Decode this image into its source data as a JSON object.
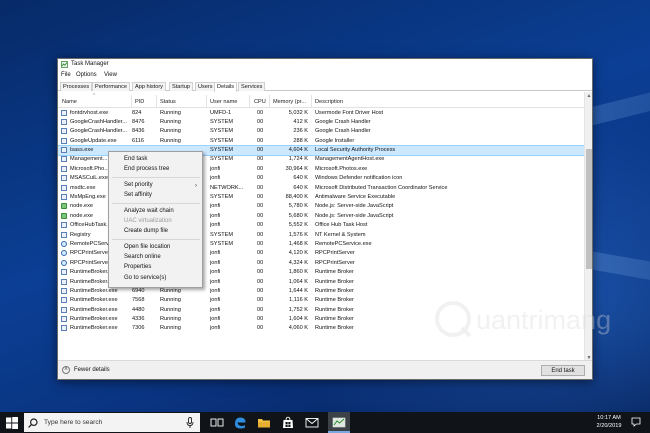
{
  "window": {
    "title": "Task Manager",
    "menu": [
      "File",
      "Options",
      "View"
    ],
    "tabs": [
      "Processes",
      "Performance",
      "App history",
      "Startup",
      "Users",
      "Details",
      "Services"
    ],
    "active_tab": "Details"
  },
  "table": {
    "columns": [
      "Name",
      "PID",
      "Status",
      "User name",
      "CPU",
      "Memory (pr...",
      "Description"
    ],
    "rows": [
      {
        "name": "fontdrvhost.exe",
        "pid": "824",
        "status": "Running",
        "user": "UMFD-1",
        "cpu": "00",
        "memory": "5,032 K",
        "description": "Usermode Font Driver Host",
        "icon": "app"
      },
      {
        "name": "GoogleCrashHandler...",
        "pid": "8476",
        "status": "Running",
        "user": "SYSTEM",
        "cpu": "00",
        "memory": "412 K",
        "description": "Google Crash Handler",
        "icon": "app"
      },
      {
        "name": "GoogleCrashHandler...",
        "pid": "8436",
        "status": "Running",
        "user": "SYSTEM",
        "cpu": "00",
        "memory": "236 K",
        "description": "Google Crash Handler",
        "icon": "app"
      },
      {
        "name": "GoogleUpdate.exe",
        "pid": "6116",
        "status": "Running",
        "user": "SYSTEM",
        "cpu": "00",
        "memory": "288 K",
        "description": "Google Installer",
        "icon": "app"
      },
      {
        "name": "lsass.exe",
        "pid": "",
        "status": "",
        "user": "SYSTEM",
        "cpu": "00",
        "memory": "4,604 K",
        "description": "Local Security Authority Process",
        "icon": "app",
        "selected": true
      },
      {
        "name": "Management...",
        "pid": "",
        "status": "",
        "user": "SYSTEM",
        "cpu": "00",
        "memory": "1,724 K",
        "description": "ManagementAgentHost.exe",
        "icon": "app"
      },
      {
        "name": "Microsoft.Pho...",
        "pid": "",
        "status": "",
        "user": "jonfi",
        "cpu": "00",
        "memory": "30,964 K",
        "description": "Microsoft.Photos.exe",
        "icon": "app"
      },
      {
        "name": "MSASCuiL.exe",
        "pid": "",
        "status": "",
        "user": "jonfi",
        "cpu": "00",
        "memory": "640 K",
        "description": "Windows Defender notification icon",
        "icon": "app"
      },
      {
        "name": "msdtc.exe",
        "pid": "",
        "status": "",
        "user": "NETWORK...",
        "cpu": "00",
        "memory": "640 K",
        "description": "Microsoft Distributed Transaction Coordinator Service",
        "icon": "app"
      },
      {
        "name": "MsMpEng.exe",
        "pid": "",
        "status": "",
        "user": "SYSTEM",
        "cpu": "00",
        "memory": "88,400 K",
        "description": "Antimalware Service Executable",
        "icon": "app"
      },
      {
        "name": "node.exe",
        "pid": "",
        "status": "",
        "user": "jonfi",
        "cpu": "00",
        "memory": "5,780 K",
        "description": "Node.js: Server-side JavaScript",
        "icon": "green"
      },
      {
        "name": "node.exe",
        "pid": "",
        "status": "",
        "user": "jonfi",
        "cpu": "00",
        "memory": "5,680 K",
        "description": "Node.js: Server-side JavaScript",
        "icon": "green"
      },
      {
        "name": "OfficeHubTask...",
        "pid": "",
        "status": "",
        "user": "jonfi",
        "cpu": "00",
        "memory": "5,552 K",
        "description": "Office Hub Task Host",
        "icon": "app"
      },
      {
        "name": "Registry",
        "pid": "",
        "status": "",
        "user": "SYSTEM",
        "cpu": "00",
        "memory": "1,576 K",
        "description": "NT Kernel & System",
        "icon": "app"
      },
      {
        "name": "RemotePCServ...",
        "pid": "",
        "status": "",
        "user": "SYSTEM",
        "cpu": "00",
        "memory": "1,468 K",
        "description": "RemotePCService.exe",
        "icon": "rpc"
      },
      {
        "name": "RPCPrintServer...",
        "pid": "",
        "status": "",
        "user": "jonfi",
        "cpu": "00",
        "memory": "4,120 K",
        "description": "RPCPrintServer",
        "icon": "rpc"
      },
      {
        "name": "RPCPrintServer...",
        "pid": "",
        "status": "",
        "user": "jonfi",
        "cpu": "00",
        "memory": "4,324 K",
        "description": "RPCPrintServer",
        "icon": "rpc"
      },
      {
        "name": "RuntimeBroker.exe",
        "pid": "3160",
        "status": "Running",
        "user": "jonfi",
        "cpu": "00",
        "memory": "1,860 K",
        "description": "Runtime Broker",
        "icon": "app"
      },
      {
        "name": "RuntimeBroker.exe",
        "pid": "6116",
        "status": "Running",
        "user": "jonfi",
        "cpu": "00",
        "memory": "1,064 K",
        "description": "Runtime Broker",
        "icon": "app"
      },
      {
        "name": "RuntimeBroker.exe",
        "pid": "6940",
        "status": "Running",
        "user": "jonfi",
        "cpu": "00",
        "memory": "1,644 K",
        "description": "Runtime Broker",
        "icon": "app"
      },
      {
        "name": "RuntimeBroker.exe",
        "pid": "7568",
        "status": "Running",
        "user": "jonfi",
        "cpu": "00",
        "memory": "1,116 K",
        "description": "Runtime Broker",
        "icon": "app"
      },
      {
        "name": "RuntimeBroker.exe",
        "pid": "4480",
        "status": "Running",
        "user": "jonfi",
        "cpu": "00",
        "memory": "1,752 K",
        "description": "Runtime Broker",
        "icon": "app"
      },
      {
        "name": "RuntimeBroker.exe",
        "pid": "4336",
        "status": "Running",
        "user": "jonfi",
        "cpu": "00",
        "memory": "1,604 K",
        "description": "Runtime Broker",
        "icon": "app"
      },
      {
        "name": "RuntimeBroker.exe",
        "pid": "7306",
        "status": "Running",
        "user": "jonfi",
        "cpu": "00",
        "memory": "4,060 K",
        "description": "Runtime Broker",
        "icon": "app"
      }
    ]
  },
  "context_menu": {
    "items": [
      {
        "label": "End task",
        "disabled": false
      },
      {
        "label": "End process tree",
        "disabled": false
      },
      {
        "label": "Set priority",
        "disabled": false,
        "submenu": true
      },
      {
        "label": "Set affinity",
        "disabled": false
      },
      {
        "label": "Analyze wait chain",
        "disabled": false
      },
      {
        "label": "UAC virtualization",
        "disabled": true
      },
      {
        "label": "Create dump file",
        "disabled": false
      },
      {
        "label": "Open file location",
        "disabled": false
      },
      {
        "label": "Search online",
        "disabled": false
      },
      {
        "label": "Properties",
        "disabled": false
      },
      {
        "label": "Go to service(s)",
        "disabled": false
      }
    ]
  },
  "footer": {
    "fewer_details": "Fewer details",
    "end_task": "End task"
  },
  "watermark": {
    "text": "uantrimang",
    "logo_letter": "Q",
    "color": "#d9d9d9"
  },
  "taskbar": {
    "search_placeholder": "Type here to search",
    "time": "10:17 AM",
    "date": "2/20/2019",
    "icons": [
      "task-view-icon",
      "edge-icon",
      "file-explorer-icon",
      "store-icon",
      "mail-icon",
      "task-manager-icon"
    ]
  },
  "colors": {
    "selected_row": "#cce8ff",
    "taskbar": "#101418",
    "accent": "#0078d7"
  }
}
